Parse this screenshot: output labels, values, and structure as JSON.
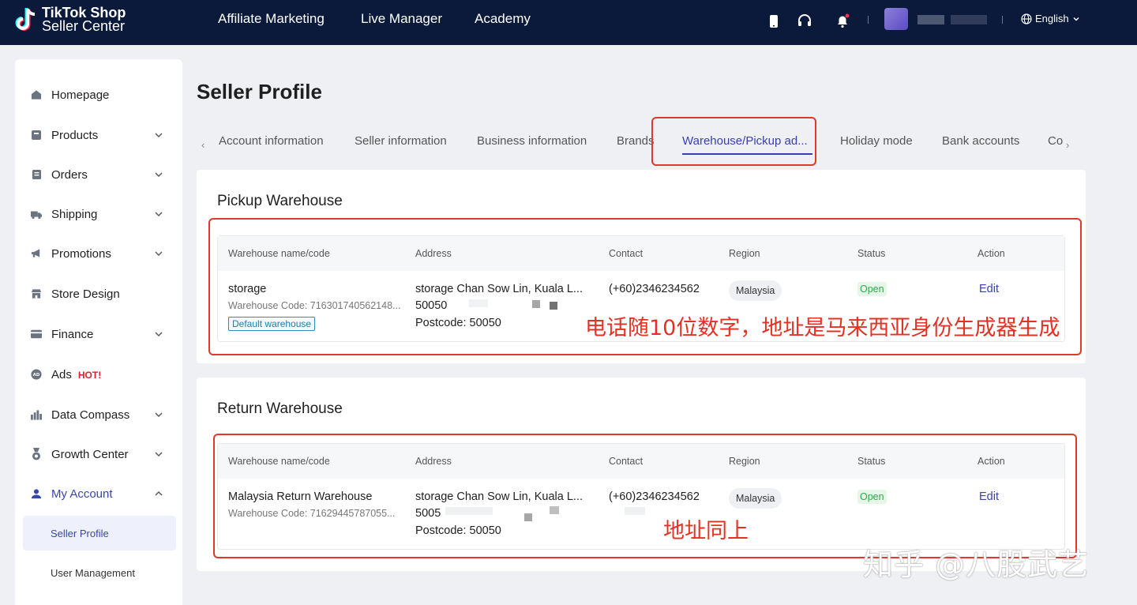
{
  "header": {
    "logo_line1": "TikTok Shop",
    "logo_line2": "Seller Center",
    "nav": [
      "Affiliate Marketing",
      "Live Manager",
      "Academy"
    ],
    "language": "English"
  },
  "sidebar": {
    "items": [
      {
        "label": "Homepage",
        "icon": "home-icon",
        "expandable": false
      },
      {
        "label": "Products",
        "icon": "products-icon",
        "expandable": true
      },
      {
        "label": "Orders",
        "icon": "orders-icon",
        "expandable": true
      },
      {
        "label": "Shipping",
        "icon": "truck-icon",
        "expandable": true
      },
      {
        "label": "Promotions",
        "icon": "megaphone-icon",
        "expandable": true
      },
      {
        "label": "Store Design",
        "icon": "store-icon",
        "expandable": false
      },
      {
        "label": "Finance",
        "icon": "card-icon",
        "expandable": true
      },
      {
        "label": "Ads",
        "icon": "ads-icon",
        "expandable": false,
        "badge": "HOT!"
      },
      {
        "label": "Data Compass",
        "icon": "chart-icon",
        "expandable": true
      },
      {
        "label": "Growth Center",
        "icon": "medal-icon",
        "expandable": true
      },
      {
        "label": "My Account",
        "icon": "user-icon",
        "expandable": true,
        "expanded": true
      }
    ],
    "sub_items": [
      "Seller Profile",
      "User Management"
    ]
  },
  "page": {
    "title": "Seller Profile",
    "tabs": [
      "Account information",
      "Seller information",
      "Business information",
      "Brands",
      "Warehouse/Pickup ad...",
      "Holiday mode",
      "Bank accounts",
      "Co"
    ],
    "active_tab": 4
  },
  "table_headers": [
    "Warehouse name/code",
    "Address",
    "Contact",
    "Region",
    "Status",
    "Action"
  ],
  "pickup": {
    "title": "Pickup Warehouse",
    "name": "storage",
    "code": "Warehouse Code: 716301740562148...",
    "default_badge": "Default warehouse",
    "address_line1": "storage  Chan Sow Lin, Kuala L...",
    "address_line2": "50050",
    "address_line3": "Postcode: 50050",
    "contact": "(+60)2346234562",
    "region": "Malaysia",
    "status": "Open",
    "action": "Edit"
  },
  "return": {
    "title": "Return Warehouse",
    "name": "Malaysia Return Warehouse",
    "code": "Warehouse Code: 71629445787055...",
    "address_line1": "storage  Chan Sow Lin, Kuala L...",
    "address_line2": "5005",
    "address_line3": "Postcode: 50050",
    "contact": "(+60)2346234562",
    "region": "Malaysia",
    "status": "Open",
    "action": "Edit"
  },
  "annotations": {
    "pickup_note": "电话随10位数字，地址是马来西亚身份生成器生成",
    "return_note": "地址同上",
    "watermark": "知乎 @八股武艺"
  },
  "colors": {
    "topbar": "#0b1a3b",
    "accent": "#3a3fae",
    "annotation_red": "#e0392b",
    "status_green": "#2fa84f"
  }
}
